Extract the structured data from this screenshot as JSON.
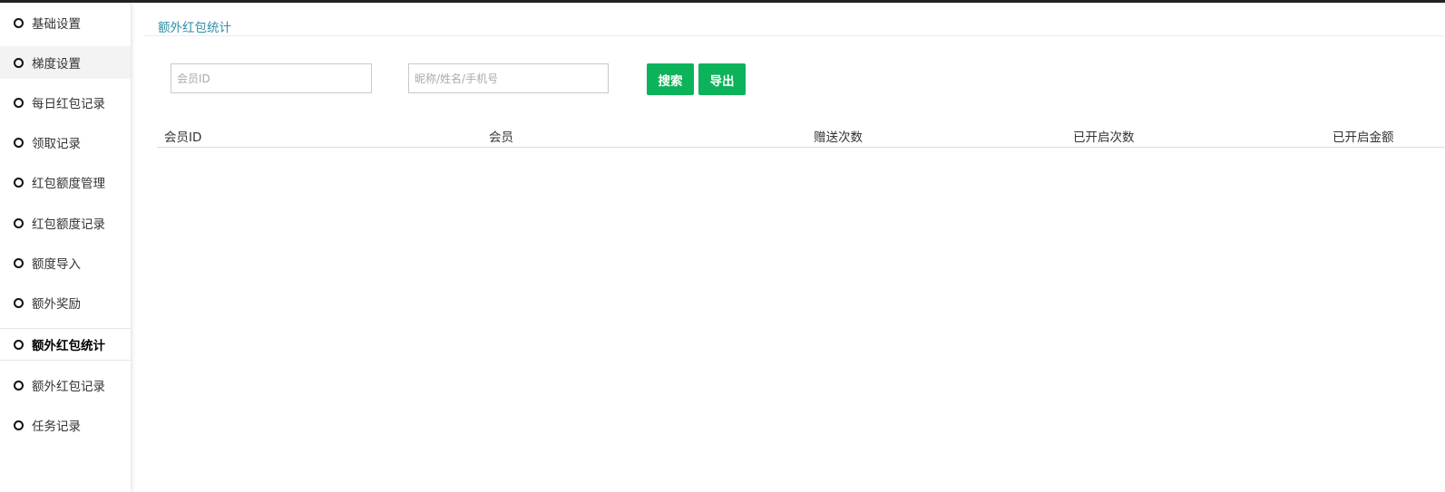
{
  "sidebar": {
    "items": [
      {
        "label": "基础设置"
      },
      {
        "label": "梯度设置"
      },
      {
        "label": "每日红包记录"
      },
      {
        "label": "领取记录"
      },
      {
        "label": "红包额度管理"
      },
      {
        "label": "红包额度记录"
      },
      {
        "label": "额度导入"
      },
      {
        "label": "额外奖励"
      },
      {
        "label": "额外红包统计"
      },
      {
        "label": "额外红包记录"
      },
      {
        "label": "任务记录"
      }
    ]
  },
  "breadcrumb": {
    "title": "额外红包统计"
  },
  "filters": {
    "member_id_placeholder": "会员ID",
    "name_placeholder": "昵称/姓名/手机号",
    "search_label": "搜索",
    "export_label": "导出"
  },
  "table": {
    "columns": [
      "会员ID",
      "会员",
      "赠送次数",
      "已开启次数",
      "已开启金额"
    ]
  },
  "colors": {
    "accent_green": "#0db35b",
    "breadcrumb_teal": "#2e8fa5"
  }
}
